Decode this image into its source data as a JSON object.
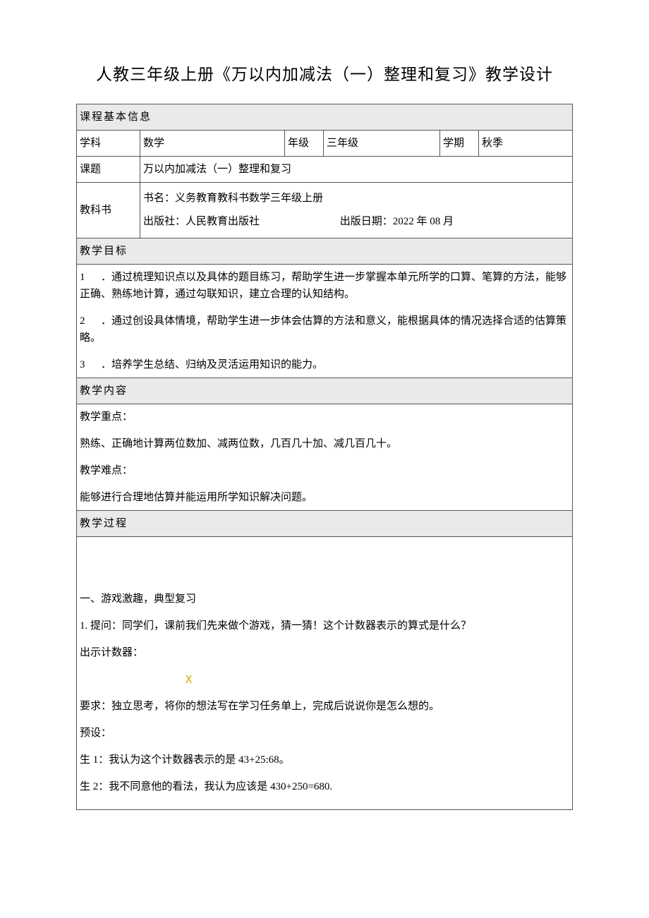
{
  "title": "人教三年级上册《万以内加减法（一）整理和复习》教学设计",
  "sections": {
    "basic_header": "课程基本信息",
    "goals_header": "教学目标",
    "content_header": "教学内容",
    "process_header": "教学过程"
  },
  "labels": {
    "subject": "学科",
    "grade": "年级",
    "term": "学期",
    "topic": "课题",
    "textbook": "教科书"
  },
  "values": {
    "subject": "数学",
    "grade": "三年级",
    "term": "秋季",
    "topic": "万以内加减法（一）整理和复习",
    "book_name": "书名：义务教育教科书数学三年级上册",
    "publisher": "出版社：人民教育出版社",
    "pub_date": "出版日期：2022 年 08 月"
  },
  "goals": {
    "g1_num": "1",
    "g1_text": "．通过梳理知识点以及具体的题目练习，帮助学生进一步掌握本单元所学的口算、笔算的方法，能够正确、熟练地计算，通过勾联知识，建立合理的认知结构。",
    "g2_num": "2",
    "g2_text": "．通过创设具体情境，帮助学生进一步体会估算的方法和意义，能根据具体的情况选择合适的估算策略。",
    "g3_num": "3",
    "g3_text": "．培养学生总结、归纳及灵活运用知识的能力。"
  },
  "content": {
    "focus_label": "教学重点：",
    "focus_text": "熟练、正确地计算两位数加、减两位数，几百几十加、减几百几十。",
    "difficulty_label": "教学难点：",
    "difficulty_text": "能够进行合理地估算并能运用所学知识解决问题。"
  },
  "process": {
    "p1": "一、游戏激趣，典型复习",
    "p2": "1. 提问：同学们，课前我们先来做个游戏，猜一猜！这个计数器表示的算式是什么？",
    "p3": "出示计数器：",
    "x": "X",
    "p4": "要求：独立思考，将你的想法写在学习任务单上，完成后说说你是怎么想的。",
    "p5": "预设：",
    "p6": "生 1：我认为这个计数器表示的是 43+25:68。",
    "p7": "生 2：我不同意他的看法，我认为应该是 430+250=680."
  }
}
